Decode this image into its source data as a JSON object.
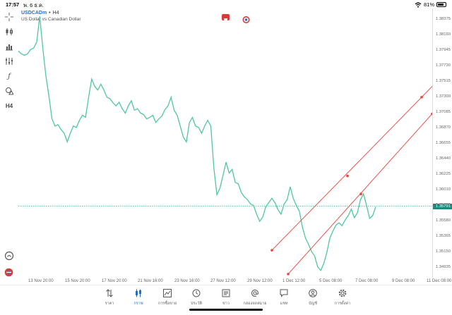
{
  "status": {
    "time": "17:57",
    "date": "พ. 6 ธ.ค.",
    "battery": "81%",
    "battery_level": 0.81
  },
  "header": {
    "symbol": "USDCADm",
    "timeframe": "H4",
    "description": "US Dollar vs Canadian Dollar"
  },
  "toolbar": {
    "items": [
      {
        "icon": "crosshair-icon"
      },
      {
        "icon": "candlestick-icon"
      },
      {
        "icon": "bar-chart-icon"
      },
      {
        "icon": "indicators-icon"
      },
      {
        "icon": "function-icon"
      },
      {
        "icon": "shapes-icon"
      },
      {
        "icon": "timeframe-label",
        "label": "H4"
      }
    ]
  },
  "price_axis": {
    "labels": [
      "1.38375",
      "1.38160",
      "1.37945",
      "1.37730",
      "1.37515",
      "1.37300",
      "1.37085",
      "1.36870",
      "1.36655",
      "1.36440",
      "1.36225",
      "1.36010",
      "1.35795",
      "1.35580",
      "1.35365",
      "1.35150",
      "1.34935"
    ],
    "current_price": "1.35791"
  },
  "time_axis": {
    "labels": [
      "13 Nov 20:00",
      "15 Nov 20:00",
      "17 Nov 20:00",
      "21 Nov 16:00",
      "23 Nov 16:00",
      "27 Nov 12:00",
      "29 Nov 12:00",
      "1 Dec 12:00",
      "5 Dec 08:00",
      "7 Dec 08:00",
      "9 Dec 08:00",
      "11 Dec 08:00"
    ]
  },
  "chart_data": {
    "type": "line",
    "symbol": "USDCADm",
    "ylim": [
      1.3482,
      1.3849
    ],
    "y": [
      1.3794,
      1.379,
      1.3788,
      1.379,
      1.3796,
      1.3798,
      1.3806,
      1.3842,
      1.3798,
      1.376,
      1.3732,
      1.37,
      1.369,
      1.3692,
      1.3685,
      1.368,
      1.3668,
      1.368,
      1.369,
      1.3688,
      1.3698,
      1.3705,
      1.3702,
      1.373,
      1.3755,
      1.3745,
      1.374,
      1.3748,
      1.374,
      1.373,
      1.3728,
      1.3722,
      1.3718,
      1.3723,
      1.3714,
      1.3708,
      1.3718,
      1.3725,
      1.3712,
      1.3714,
      1.3708,
      1.3706,
      1.37,
      1.3702,
      1.3705,
      1.3695,
      1.37,
      1.3704,
      1.3713,
      1.3718,
      1.373,
      1.3712,
      1.3705,
      1.369,
      1.3675,
      1.3668,
      1.3695,
      1.3702,
      1.369,
      1.3688,
      1.368,
      1.369,
      1.3698,
      1.369,
      1.3632,
      1.3595,
      1.3604,
      1.3622,
      1.364,
      1.3625,
      1.363,
      1.3612,
      1.361,
      1.3598,
      1.3592,
      1.3588,
      1.3582,
      1.358,
      1.3568,
      1.3558,
      1.3564,
      1.3578,
      1.3584,
      1.359,
      1.3584,
      1.3574,
      1.3568,
      1.3582,
      1.3588,
      1.3606,
      1.359,
      1.358,
      1.3572,
      1.355,
      1.3535,
      1.3526,
      1.3516,
      1.351,
      1.3495,
      1.349,
      1.35,
      1.3515,
      1.3535,
      1.3545,
      1.3553,
      1.3556,
      1.3552,
      1.356,
      1.3566,
      1.3575,
      1.3563,
      1.357,
      1.3588,
      1.3596,
      1.358,
      1.3562,
      1.3566,
      1.3578
    ],
    "channel_lines": [
      {
        "name": "upper",
        "points": [
          [
            385,
            1.3518
          ],
          [
            492,
            1.3621
          ],
          [
            597,
            1.373
          ]
        ]
      },
      {
        "name": "lower",
        "points": [
          [
            408,
            1.3485
          ],
          [
            511,
            1.3596
          ],
          [
            612,
            1.3707
          ]
        ]
      }
    ],
    "current_price": 1.35791,
    "color": "#4fc89a",
    "channel_color": "#e8433a"
  },
  "bottom_icons": [
    {
      "icon": "clock-icon"
    },
    {
      "icon": "one-click-trading-icon"
    }
  ],
  "tabs": [
    {
      "label": "ราคา",
      "icon": "arrows-updown-icon",
      "active": false
    },
    {
      "label": "กราฟ",
      "icon": "candles-icon",
      "active": true
    },
    {
      "label": "การซื้อขาย",
      "icon": "trade-chart-icon",
      "active": false
    },
    {
      "label": "ประวัติ",
      "icon": "history-icon",
      "active": false
    },
    {
      "label": "ข่าว",
      "icon": "news-icon",
      "active": false
    },
    {
      "label": "กล่องจดหมาย",
      "icon": "mail-icon",
      "active": false
    },
    {
      "label": "แชท",
      "icon": "chat-icon",
      "active": false
    },
    {
      "label": "บัญชี",
      "icon": "account-icon",
      "active": false
    },
    {
      "label": "การตั้งค่า",
      "icon": "settings-icon",
      "active": false
    }
  ]
}
